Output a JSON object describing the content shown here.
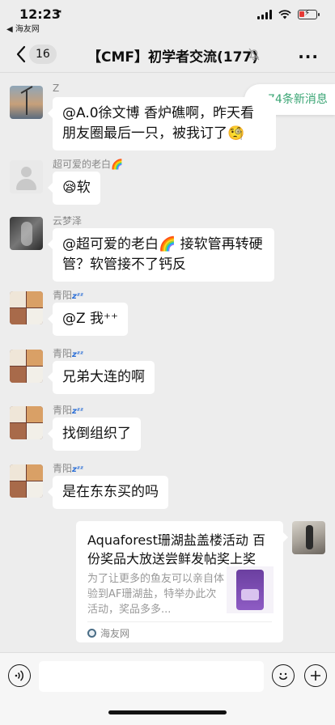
{
  "status_bar": {
    "time": "12:23",
    "back_app": "◀ 海友网"
  },
  "nav": {
    "unread_count": "16",
    "title": "【CMF】初学者交流(177)"
  },
  "new_messages_banner": {
    "text": "74条新消息"
  },
  "messages": [
    {
      "sender": "Z",
      "text": "@A.0徐文博 香炉礁啊，昨天看朋友圈最后一只，被我订了🧐",
      "avatar": "z-avatar"
    },
    {
      "sender": "超可爱的老白🌈",
      "text": "😪软",
      "avatar": "default-avatar"
    },
    {
      "sender": "云梦泽",
      "text": "@超可爱的老白🌈 接软管再转硬管？软管接不了钙反",
      "avatar": "yun-avatar"
    },
    {
      "sender": "青阳",
      "sender_suffix": "zᶻᶻ",
      "text": "@Z 我⁺⁺",
      "avatar": "cats-avatar"
    },
    {
      "sender": "青阳",
      "sender_suffix": "zᶻᶻ",
      "text": "兄弟大连的啊",
      "avatar": "cats-avatar"
    },
    {
      "sender": "青阳",
      "sender_suffix": "zᶻᶻ",
      "text": "找倒组织了",
      "avatar": "cats-avatar"
    },
    {
      "sender": "青阳",
      "sender_suffix": "zᶻᶻ",
      "text": "是在东东买的吗",
      "avatar": "cats-avatar"
    }
  ],
  "link_card": {
    "title": "Aquaforest珊湖盐盖楼活动 百份奖品大放送尝鲜发帖奖上奖",
    "description": "为了让更多的鱼友可以亲自体验到AF珊湖盐，特举办此次活动，奖品多多...",
    "source": "海友网"
  },
  "input_bar": {
    "voice_icon": "voice-icon",
    "emoji_icon": "emoji-icon",
    "plus_icon": "plus-icon"
  },
  "colors": {
    "background": "#ededed",
    "bubble": "#ffffff",
    "accent_green": "#3aa574",
    "battery_low": "#e53935"
  }
}
